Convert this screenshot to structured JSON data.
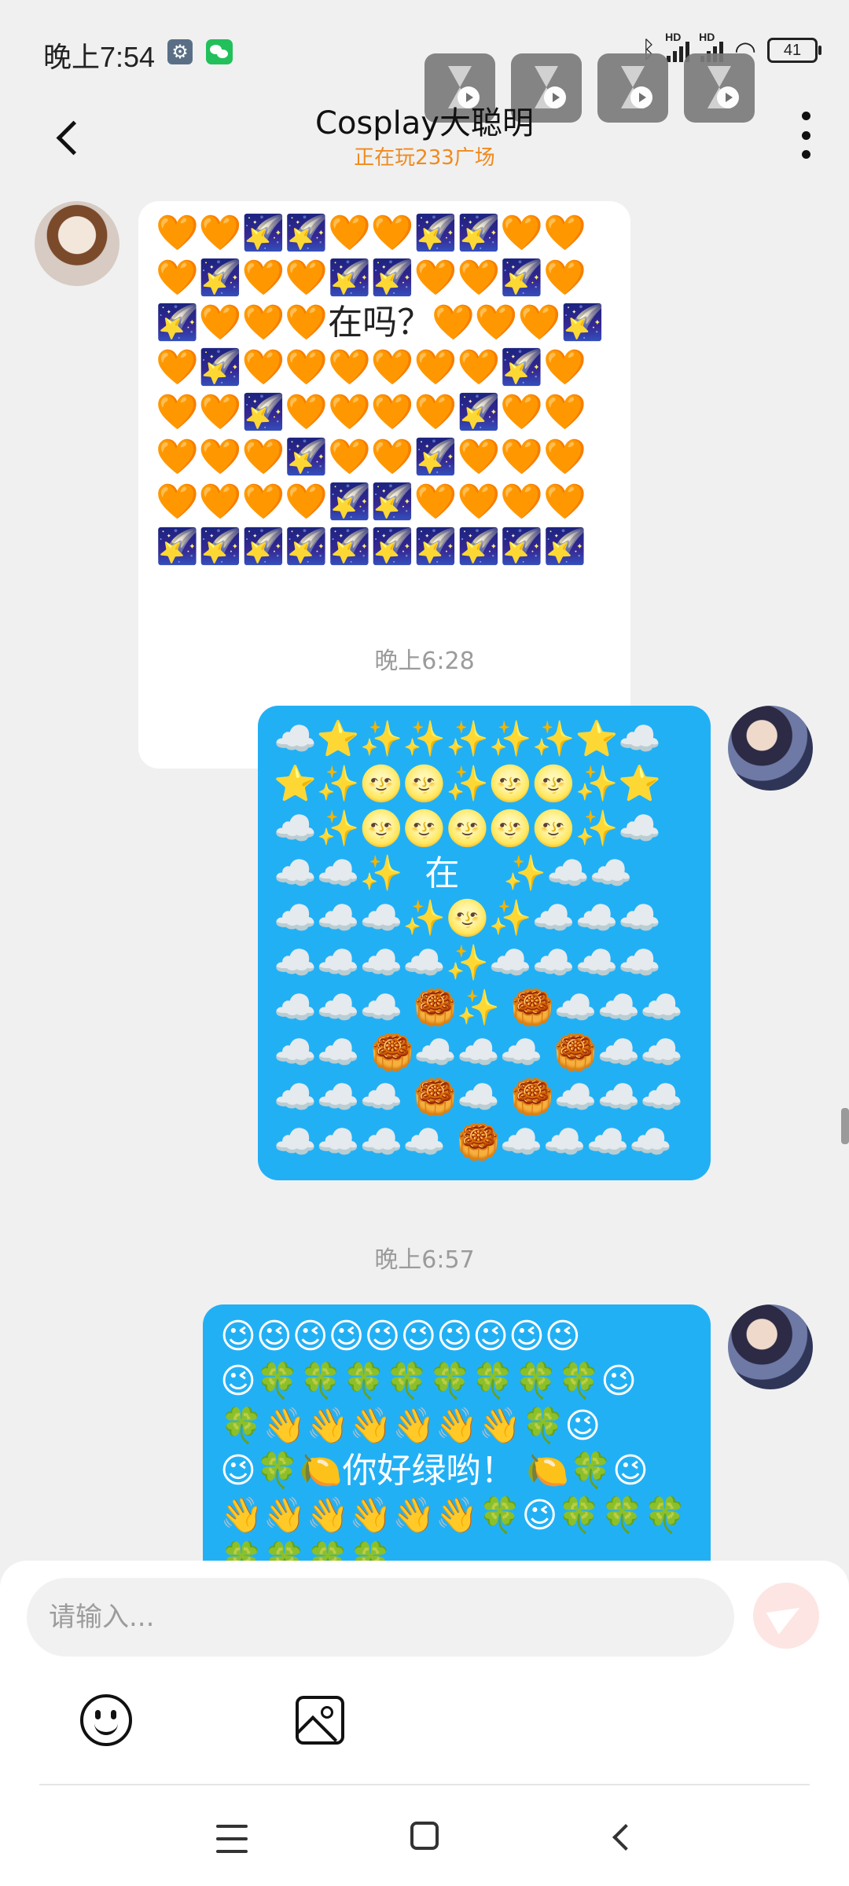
{
  "status_bar": {
    "time": "晚上7:54",
    "hd_label": "HD",
    "battery": "41"
  },
  "header": {
    "title": "Cosplay大聪明",
    "subtitle": "正在玩233广场"
  },
  "messages": [
    {
      "side": "left",
      "content": "🧡🧡🌠🌠🧡🧡🌠🌠🧡🧡\n🧡🌠🧡🧡🌠🌠🧡🧡🌠🧡\n🌠🧡🧡🧡在吗？🧡🧡🧡🌠\n🧡🌠🧡🧡🧡🧡🧡🧡🌠🧡\n🧡🧡🌠🧡🧡🧡🧡🌠🧡🧡\n🧡🧡🧡🌠🧡🧡🌠🧡🧡🧡\n🧡🧡🧡🧡🌠🌠🧡🧡🧡🧡\n🌠🌠🌠🌠🌠🌠🌠🌠🌠🌠"
    },
    {
      "timestamp": "晚上6:28"
    },
    {
      "side": "right",
      "content": "☁️⭐✨✨✨✨✨⭐☁️\n⭐✨🌝🌝✨🌝🌝✨⭐\n☁️✨🌝🌝🌝🌝🌝✨☁️\n☁️☁️✨  在    ✨☁️☁️\n☁️☁️☁️✨🌝✨☁️☁️☁️\n☁️☁️☁️☁️✨☁️☁️☁️☁️\n☁️☁️☁️ 🥮✨ 🥮☁️☁️☁️\n☁️☁️ 🥮☁️☁️☁️ 🥮☁️☁️\n☁️☁️☁️ 🥮☁️ 🥮☁️☁️☁️\n☁️☁️☁️☁️ 🥮☁️☁️☁️☁️"
    },
    {
      "timestamp": "晚上6:57"
    },
    {
      "side": "right",
      "content": "😉😉😉😉😉😉😉😉😉😉\n😉🍀🍀🍀🍀🍀🍀🍀🍀😉\n🍀👋👋👋👋👋👋🍀😉\n😉🍀🍋你好绿哟！ 🍋🍀😉\n👋👋👋👋👋👋🍀😉🍀🍀🍀\n🍀🍀🍀🍀"
    }
  ],
  "input": {
    "placeholder": "请输入..."
  },
  "icons": {
    "gear": "settings-notification-icon",
    "wechat": "wechat-notification-icon",
    "bluetooth": "bluetooth-icon",
    "emoji": "emoji-icon",
    "image": "image-icon",
    "send": "send-icon"
  }
}
